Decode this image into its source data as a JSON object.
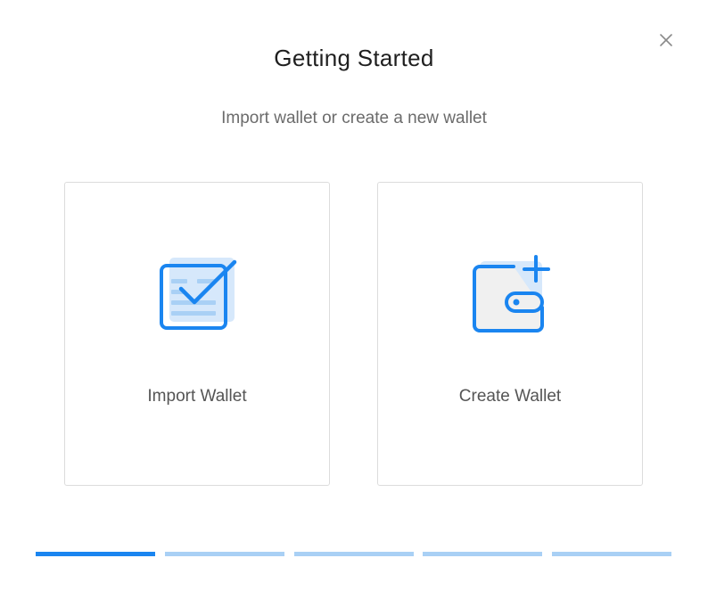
{
  "dialog": {
    "title": "Getting Started",
    "subtitle": "Import wallet or create a new wallet",
    "close_icon": "close-icon"
  },
  "options": [
    {
      "label": "Import Wallet",
      "icon": "import-wallet-icon"
    },
    {
      "label": "Create Wallet",
      "icon": "create-wallet-icon"
    }
  ],
  "progress": {
    "total_steps": 5,
    "current_step": 1
  },
  "colors": {
    "accent": "#1a85f0",
    "accent_light": "#a9d0f5",
    "icon_fill": "#d6e8fb",
    "text_primary": "#1f1f1f",
    "text_secondary": "#6b6b6b"
  }
}
